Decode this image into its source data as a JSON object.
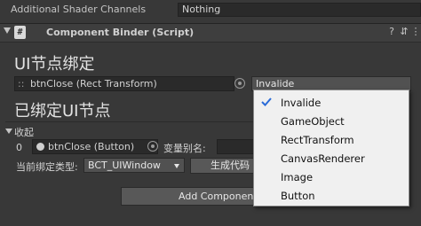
{
  "shader_row": {
    "label": "Additional Shader Channels",
    "value": "Nothing"
  },
  "component": {
    "title": "Component Binder (Script)",
    "script_icon": "#",
    "help_icon": "?",
    "settings_icon": "⇵",
    "menu_icon": "⋮"
  },
  "section1": {
    "title": "UI节点绑定",
    "object_field": "btnClose (Rect Transform)",
    "enum_value": "Invalide"
  },
  "section2": {
    "title": "已绑定UI节点"
  },
  "bound": {
    "collapse_label": "收起",
    "index": "0",
    "object": "btnClose (Button)",
    "alias_label": "变量别名:",
    "type_label": "当前绑定类型:",
    "type_value": "BCT_UIWindow",
    "generate_button": "生成代码"
  },
  "add_component_button": "Add Componen",
  "dropdown": {
    "selected": "Invalide",
    "options": [
      "Invalide",
      "GameObject",
      "RectTransform",
      "CanvasRenderer",
      "Image",
      "Button"
    ]
  }
}
